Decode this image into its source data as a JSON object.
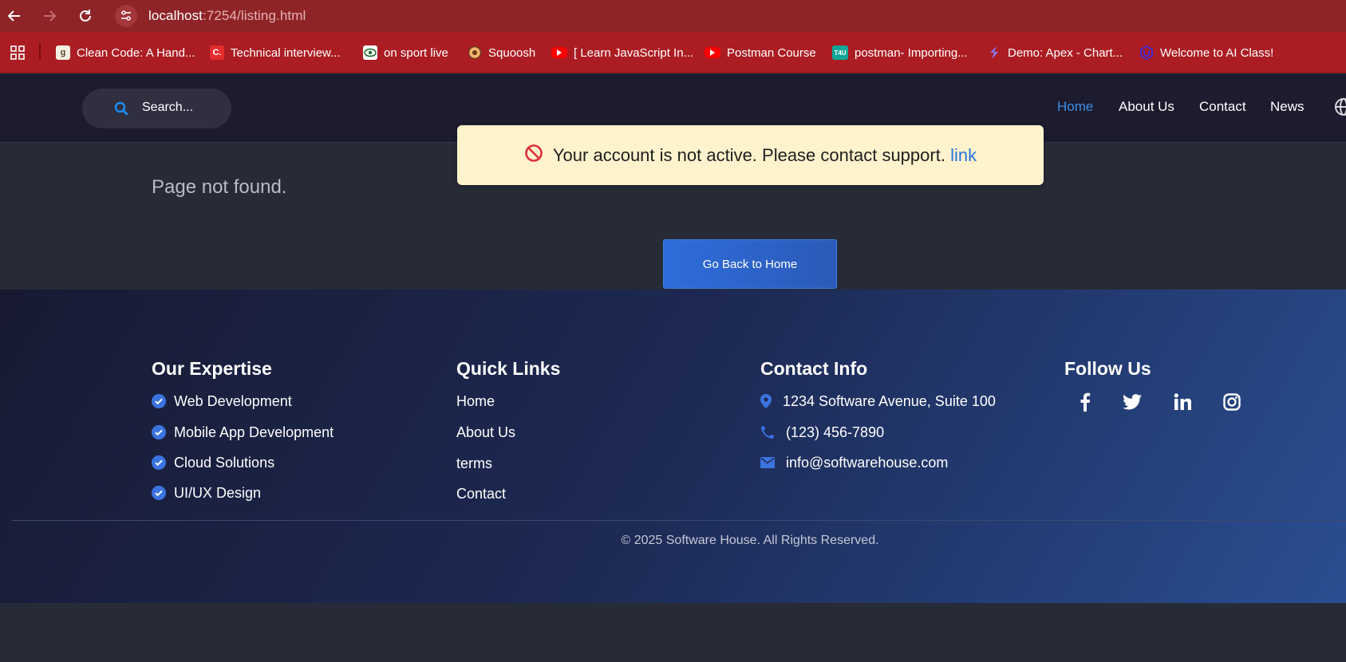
{
  "browser": {
    "url_host": "localhost",
    "url_path": ":7254/listing.html",
    "bookmarks": [
      {
        "label": "Clean Code: A Hand...",
        "icon": "goodreads-icon"
      },
      {
        "label": "Technical interview...",
        "icon": "c-icon"
      },
      {
        "label": "on sport live",
        "icon": "eye-icon"
      },
      {
        "label": "Squoosh",
        "icon": "squoosh-icon"
      },
      {
        "label": "[ Learn JavaScript In...",
        "icon": "youtube-icon"
      },
      {
        "label": "Postman Course",
        "icon": "youtube-icon"
      },
      {
        "label": "postman- Importing...",
        "icon": "t4u-icon"
      },
      {
        "label": "Demo: Apex - Chart...",
        "icon": "apex-icon"
      },
      {
        "label": "Welcome to AI Class!",
        "icon": "udacity-icon"
      }
    ],
    "t4u_badge": "T4U",
    "c_badge": "C."
  },
  "header": {
    "search_placeholder": "Search...",
    "nav": [
      "Home",
      "About Us",
      "Contact",
      "News"
    ],
    "active_nav": "Home",
    "accent_color": "#3b8fe8"
  },
  "main": {
    "page_not_found": "Page not found.",
    "alert_text": "Your account is not active. Please contact support.",
    "alert_link": "link",
    "back_button": "Go Back to Home"
  },
  "footer": {
    "expertise": {
      "title": "Our Expertise",
      "items": [
        "Web Development",
        "Mobile App Development",
        "Cloud Solutions",
        "UI/UX Design"
      ]
    },
    "quick_links": {
      "title": "Quick Links",
      "items": [
        "Home",
        "About Us",
        "terms",
        "Contact"
      ]
    },
    "contact": {
      "title": "Contact Info",
      "address": "1234 Software Avenue, Suite 100",
      "phone": "(123) 456-7890",
      "email": "info@softwarehouse.com"
    },
    "follow": {
      "title": "Follow Us",
      "icons": [
        "facebook-icon",
        "twitter-icon",
        "linkedin-icon",
        "instagram-icon"
      ]
    },
    "copyright": "© 2025 Software House. All Rights Reserved."
  }
}
